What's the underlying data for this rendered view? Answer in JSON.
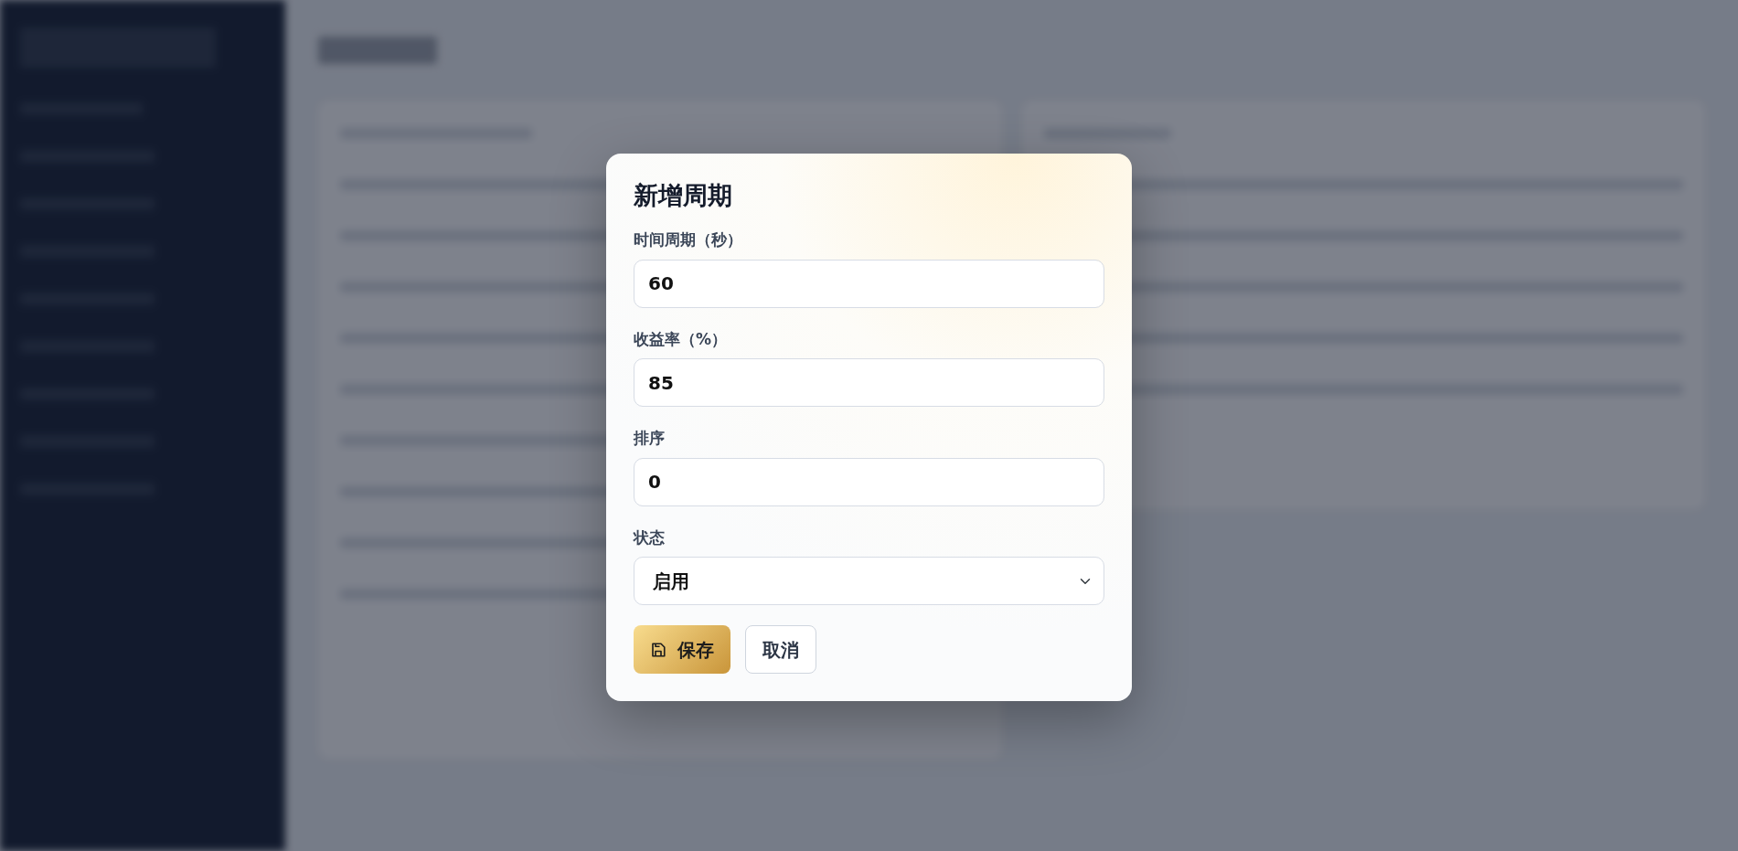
{
  "modal": {
    "title": "新增周期",
    "fields": [
      {
        "kind": "input",
        "label": "时间周期（秒）",
        "value": "60"
      },
      {
        "kind": "input",
        "label": "收益率（%）",
        "value": "85"
      },
      {
        "kind": "input",
        "label": "排序",
        "value": "0"
      },
      {
        "kind": "select",
        "label": "状态",
        "value": "启用"
      }
    ],
    "buttons": [
      {
        "kind": "primary",
        "label": "保存"
      },
      {
        "kind": "secondary",
        "label": "取消"
      }
    ]
  }
}
